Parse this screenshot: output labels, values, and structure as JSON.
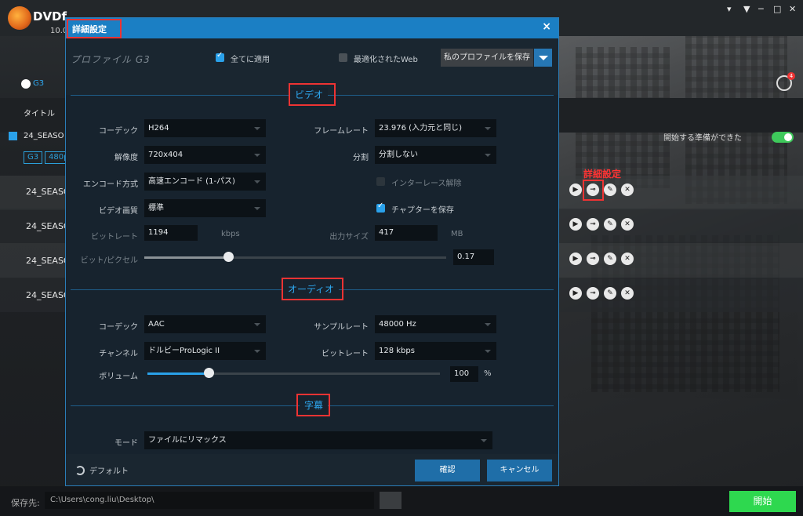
{
  "app": {
    "logo_text": "DVDf",
    "version": "10.0",
    "header_link": "G3",
    "column_title": "タイトル",
    "group_title": "24_SEASO",
    "badges": [
      "G3",
      "480p"
    ],
    "ready_label": "開始する準備ができた",
    "notification_count": "4",
    "rows": [
      "24_SEASO",
      "24_SEASO",
      "24_SEASO",
      "24_SEASO"
    ],
    "annotation_label": "詳細設定",
    "window_controls": [
      "▾",
      "─",
      "□",
      "✕"
    ]
  },
  "bottom": {
    "save_label": "保存先:",
    "save_path": "C:\\Users\\cong.liu\\Desktop\\",
    "start_label": "開始"
  },
  "dialog": {
    "title": "詳細設定",
    "close_icon": "×",
    "profile_name": "プロファイル G3",
    "apply_all_label": "全てに適用",
    "apply_all_checked": true,
    "web_optimized_label": "最適化されたWeb",
    "web_optimized_checked": false,
    "save_profile_label": "私のプロファイルを保存",
    "video": {
      "section_title": "ビデオ",
      "codec_label": "コーデック",
      "codec_value": "H264",
      "framerate_label": "フレームレート",
      "framerate_value": "23.976 (入力元と同じ)",
      "resolution_label": "解像度",
      "resolution_value": "720x404",
      "split_label": "分割",
      "split_value": "分割しない",
      "encode_label": "エンコード方式",
      "encode_value": "高速エンコード (1-パス)",
      "deinterlace_label": "インターレース解除",
      "deinterlace_checked": false,
      "quality_label": "ビデオ画質",
      "quality_value": "標準",
      "keep_chapters_label": "チャプターを保存",
      "keep_chapters_checked": true,
      "bitrate_label": "ビットレート",
      "bitrate_value": "1194",
      "bitrate_unit": "kbps",
      "output_size_label": "出力サイズ",
      "output_size_value": "417",
      "output_size_unit": "MB",
      "bpp_label": "ビット/ピクセル",
      "bpp_value": "0.17",
      "bpp_slider_fraction": 0.28
    },
    "audio": {
      "section_title": "オーディオ",
      "codec_label": "コーデック",
      "codec_value": "AAC",
      "samplerate_label": "サンプルレート",
      "samplerate_value": "48000 Hz",
      "channel_label": "チャンネル",
      "channel_value": "ドルビーProLogic II",
      "bitrate_label": "ビットレート",
      "bitrate_value": "128 kbps",
      "volume_label": "ボリューム",
      "volume_value": "100",
      "volume_unit": "%",
      "volume_slider_fraction": 0.21
    },
    "subtitle": {
      "section_title": "字幕",
      "mode_label": "モード",
      "mode_value": "ファイルにリマックス"
    },
    "footer": {
      "default_label": "デフォルト",
      "ok_label": "確認",
      "cancel_label": "キャンセル"
    }
  },
  "colors": {
    "accent_blue": "#2aa1ea",
    "title_bar": "#1b7fc4",
    "start_green": "#2ed84f",
    "annotation_red": "#ff3333"
  }
}
